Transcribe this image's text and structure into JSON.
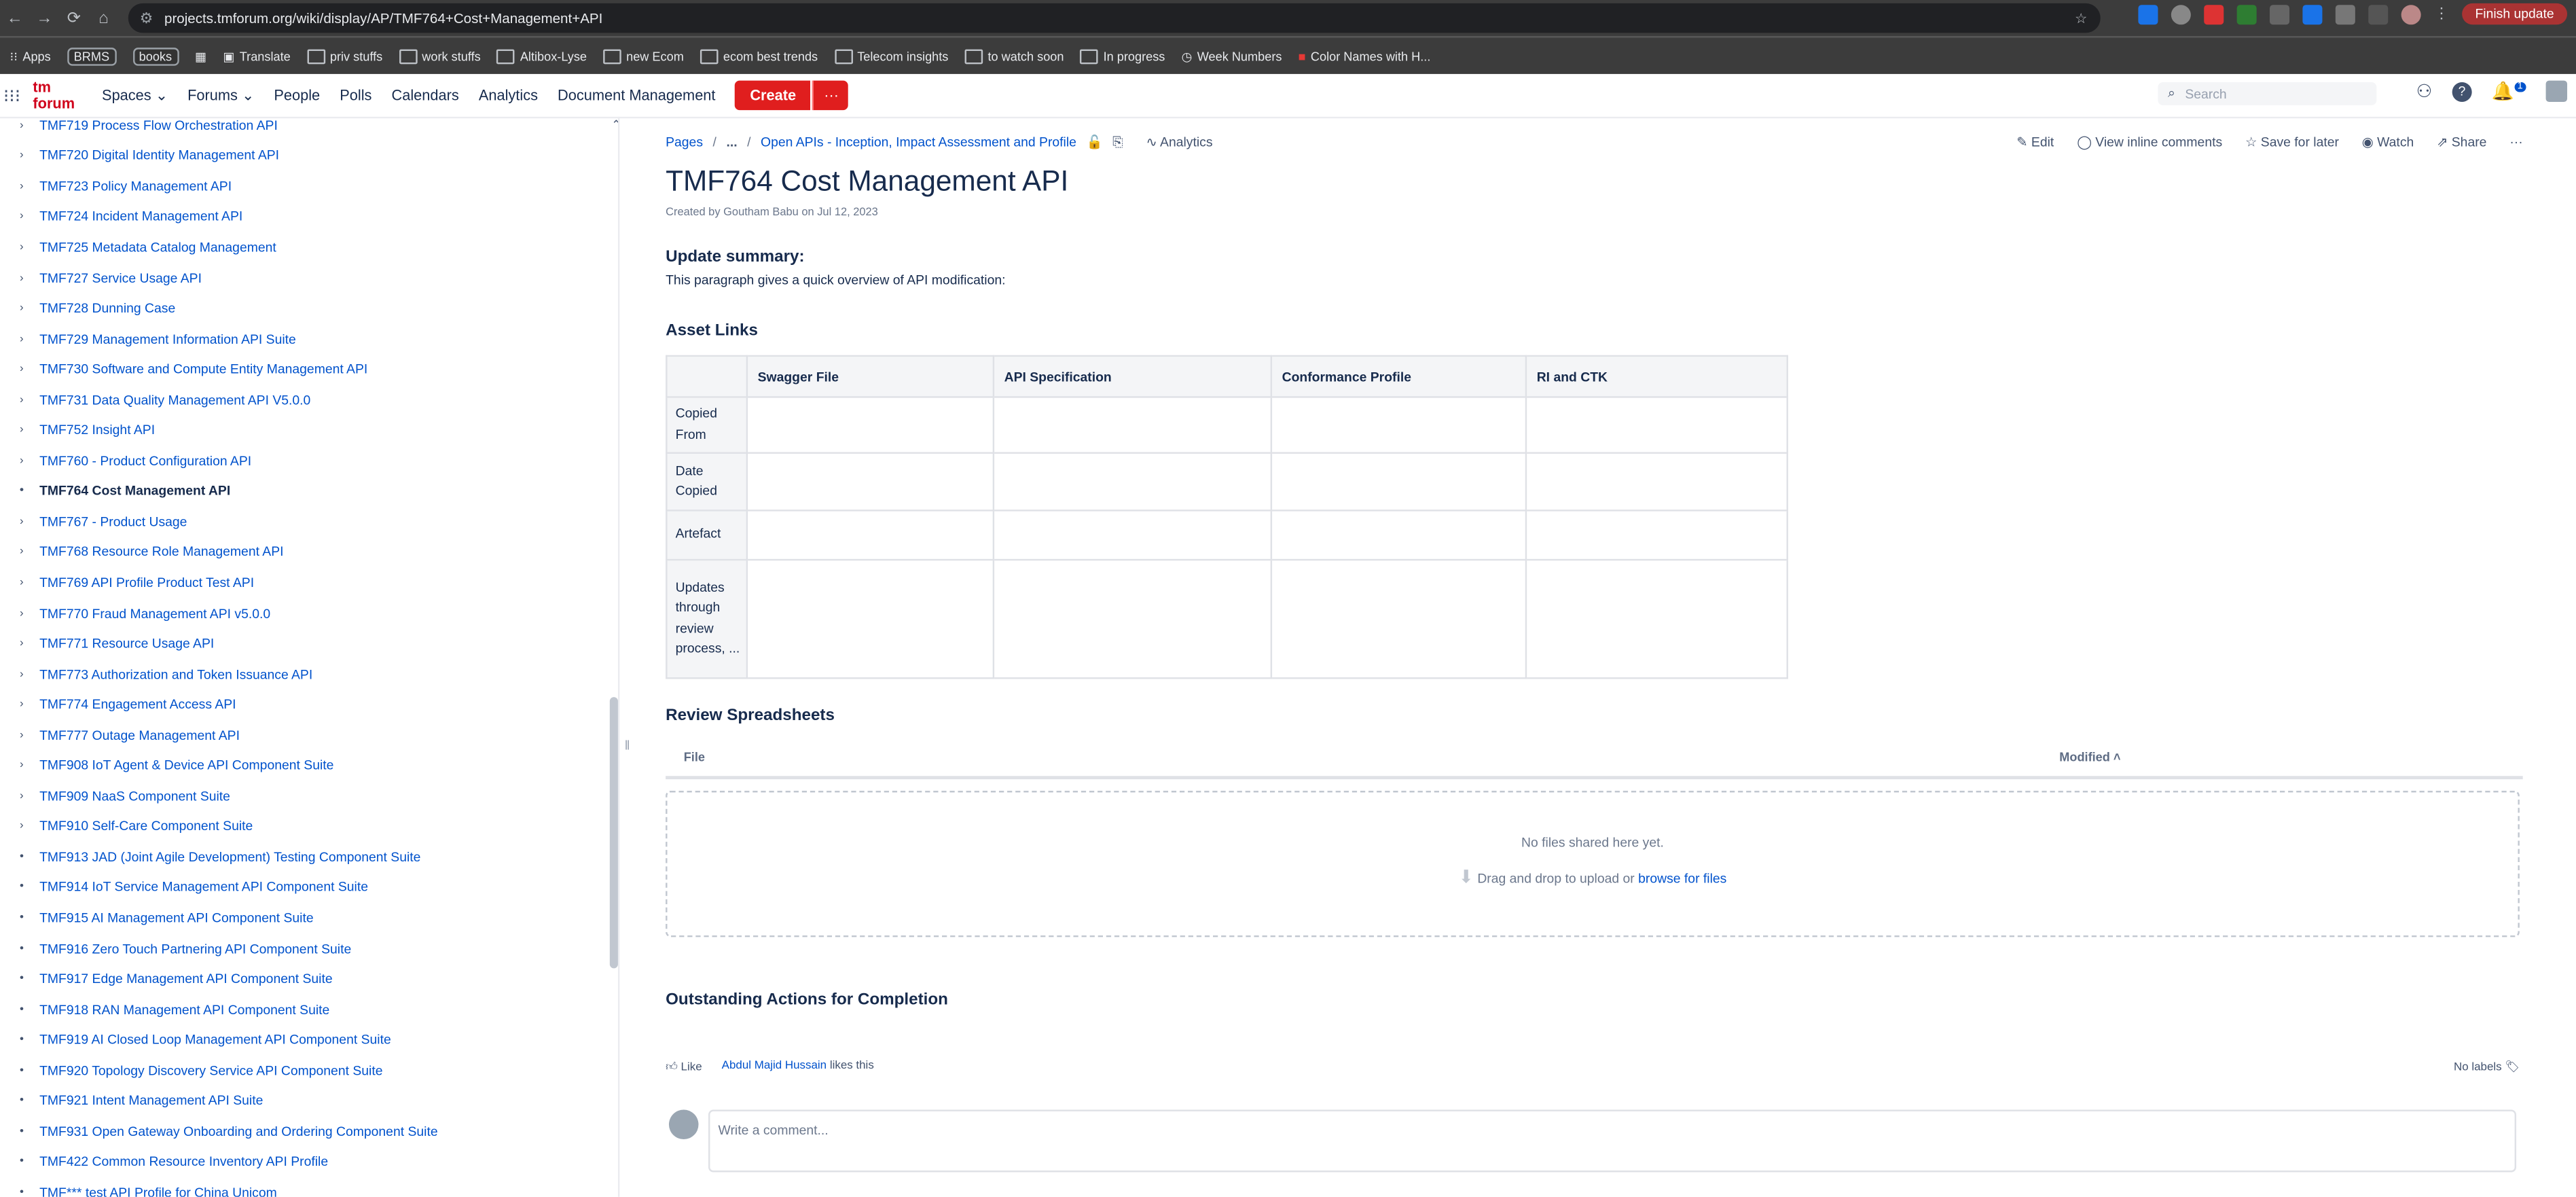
{
  "browser": {
    "url": "projects.tmforum.org/wiki/display/AP/TMF764+Cost+Management+API",
    "finish_update": "Finish update",
    "bookmarks": [
      "Apps",
      "BRMS",
      "books",
      "Translate",
      "priv stuffs",
      "work stuffs",
      "Altibox-Lyse",
      "new Ecom",
      "ecom best trends",
      "Telecom insights",
      "to watch soon",
      "In progress",
      "Week Numbers",
      "Color Names with H..."
    ]
  },
  "header": {
    "logo": "tm forum",
    "nav": [
      "Spaces",
      "People",
      "Polls",
      "Calendars",
      "Analytics",
      "Document Management"
    ],
    "forums": "Forums",
    "create": "Create",
    "search_placeholder": "Search",
    "notif_count": "1"
  },
  "sidebar": {
    "items": [
      "TMF719 Process Flow Orchestration API",
      "TMF720 Digital Identity Management API",
      "TMF723 Policy Management API",
      "TMF724 Incident Management API",
      "TMF725 Metadata Catalog Management",
      "TMF727 Service Usage API",
      "TMF728 Dunning Case",
      "TMF729 Management Information API Suite",
      "TMF730 Software and Compute Entity Management API",
      "TMF731 Data Quality Management API V5.0.0",
      "TMF752 Insight API",
      "TMF760 - Product Configuration API",
      "TMF764 Cost Management API",
      "TMF767 - Product Usage",
      "TMF768 Resource Role Management API",
      "TMF769 API Profile Product Test API",
      "TMF770 Fraud Management API v5.0.0",
      "TMF771 Resource Usage API",
      "TMF773 Authorization and Token Issuance API",
      "TMF774 Engagement Access API",
      "TMF777 Outage Management API",
      "TMF908 IoT Agent & Device API Component Suite",
      "TMF909 NaaS Component Suite",
      "TMF910 Self-Care Component Suite",
      "TMF913 JAD (Joint Agile Development) Testing Component Suite",
      "TMF914 IoT Service Management API Component Suite",
      "TMF915 AI Management API Component Suite",
      "TMF916 Zero Touch Partnering API Component Suite",
      "TMF917 Edge Management API Component Suite",
      "TMF918 RAN Management API Component Suite",
      "TMF919 AI Closed Loop Management API Component Suite",
      "TMF920 Topology Discovery Service API Component Suite",
      "TMF921 Intent Management API Suite",
      "TMF931 Open Gateway Onboarding and Ordering Component Suite",
      "TMF422 Common Resource Inventory API Profile",
      "TMF*** test API Profile for China Unicom"
    ]
  },
  "page": {
    "breadcrumb": {
      "pages": "Pages",
      "ellipsis": "...",
      "parent": "Open APIs - Inception, Impact Assessment and Profile"
    },
    "analytics": "Analytics",
    "actions": [
      "Edit",
      "View inline comments",
      "Save for later",
      "Watch",
      "Share"
    ],
    "title": "TMF764 Cost Management API",
    "byline": "Created by Goutham Babu on Jul 12, 2023",
    "update_summary_title": "Update summary:",
    "update_summary_text": "This paragraph gives a quick overview of API modification:",
    "asset_links_title": "Asset Links",
    "table": {
      "headers": [
        "Swagger File",
        "API Specification",
        "Conformance Profile",
        "RI and CTK"
      ],
      "rows": [
        "Copied From",
        "Date Copied",
        "Artefact",
        "Updates through review process, ..."
      ]
    },
    "review_title": "Review Spreadsheets",
    "file_col": "File",
    "modified_col": "Modified",
    "no_files": "No files shared here yet.",
    "drag_text": "Drag and drop to upload or",
    "browse": "browse for files",
    "outstanding_title": "Outstanding Actions for Completion",
    "like": "Like",
    "liker": "Abdul Majid Hussain",
    "likes_suffix": "likes this",
    "no_labels": "No labels",
    "comment_placeholder": "Write a comment..."
  }
}
